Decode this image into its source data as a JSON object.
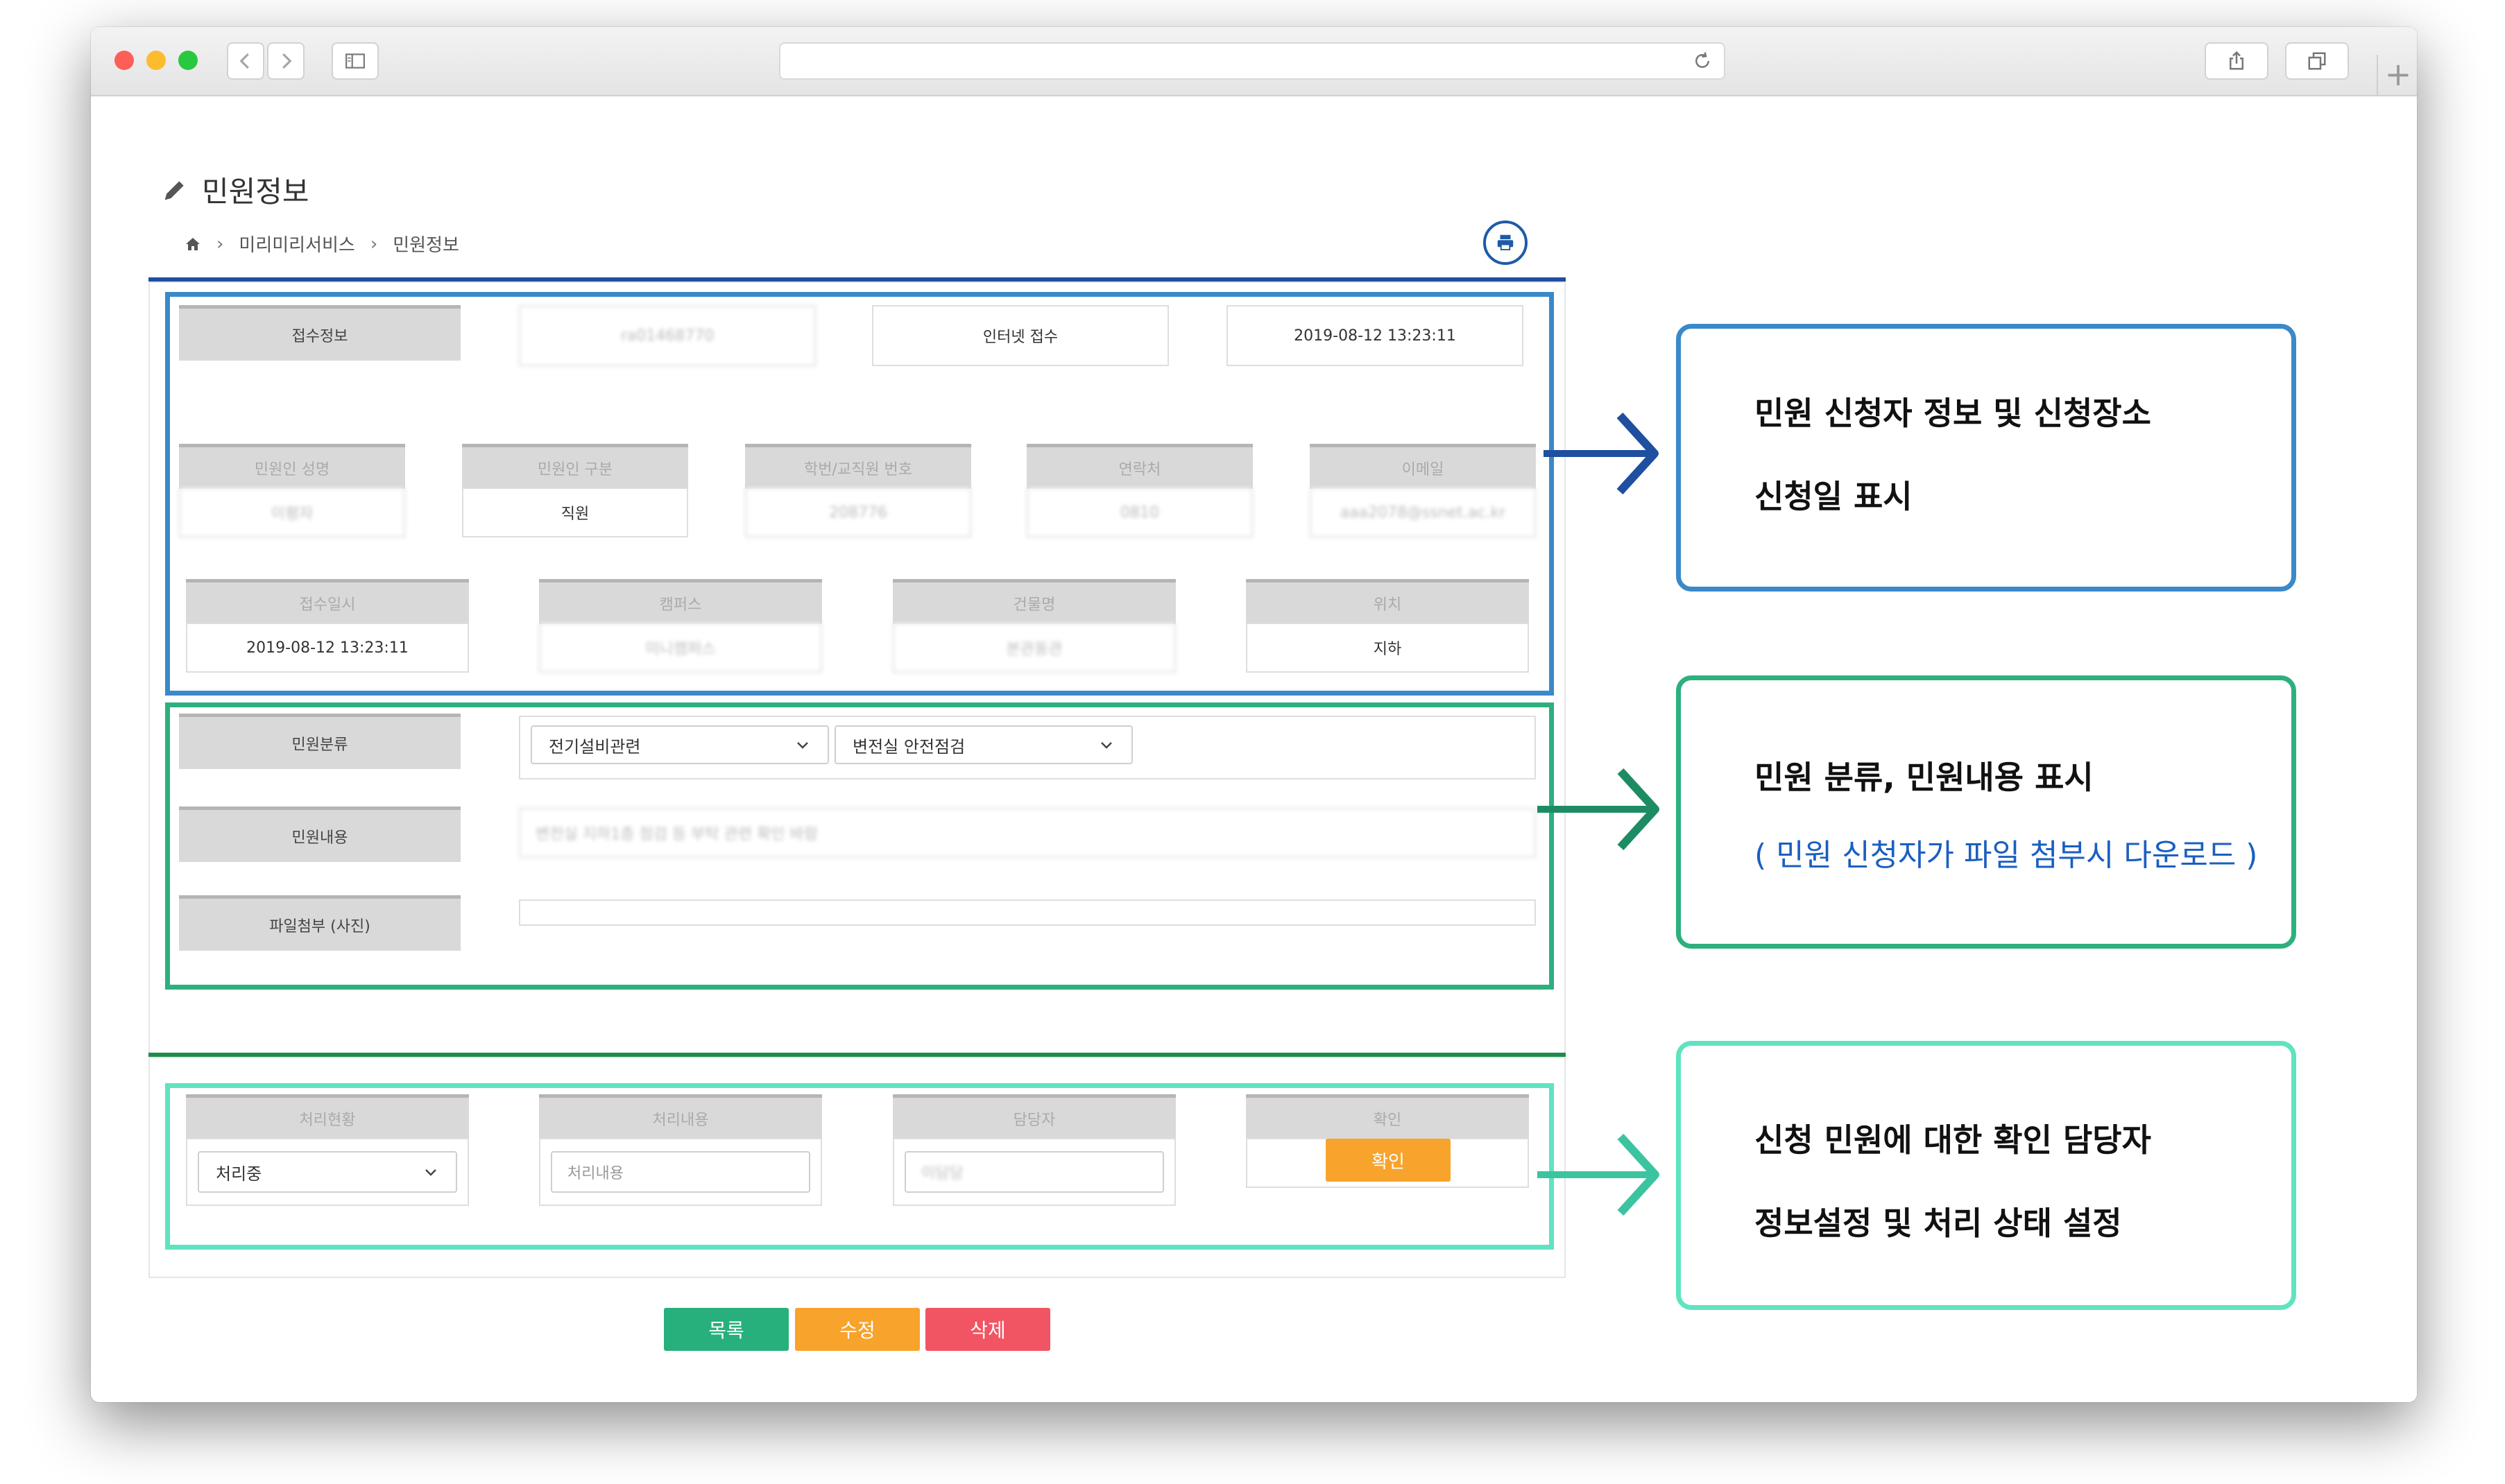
{
  "page": {
    "title": "민원정보",
    "breadcrumb": [
      "미리미리서비스",
      "민원정보"
    ]
  },
  "reception": {
    "label": "접수정보",
    "number": "ra01468770",
    "channel": "인터넷 접수",
    "datetime": "2019-08-12 13:23:11"
  },
  "applicant": {
    "labels": [
      "민원인 성명",
      "민원인 구분",
      "학번/교직원 번호",
      "연락처",
      "이메일"
    ],
    "values": [
      "이평자",
      "직원",
      "208776",
      "0810",
      "aaa2078@ssnet.ac.kr"
    ]
  },
  "location": {
    "labels": [
      "접수일시",
      "캠퍼스",
      "건물명",
      "위치"
    ],
    "values": [
      "2019-08-12 13:23:11",
      "미니캠퍼스",
      "본관동관",
      "지하"
    ]
  },
  "complaint": {
    "category_label": "민원분류",
    "category1": "전기설비관련",
    "category2": "변전실 안전점검",
    "content_label": "민원내용",
    "content_value": "변전실 지하1층 점검 등 부탁 관련 확인 바람",
    "file_label": "파일첨부 (사진)"
  },
  "processing": {
    "labels": [
      "처리현황",
      "처리내용",
      "담당자",
      "확인"
    ],
    "status_value": "처리중",
    "content_placeholder": "처리내용",
    "manager_value": "이담당",
    "confirm_button": "확인"
  },
  "actions": {
    "list": "목록",
    "edit": "수정",
    "delete": "삭제"
  },
  "notes": {
    "note1": [
      "민원 신청자 정보 및 신청장소",
      "신청일 표시"
    ],
    "note2": [
      "민원 분류, 민원내용 표시",
      "( 민원 신청자가 파일 첨부시 다운로드 )"
    ],
    "note3": [
      "신청 민원에 대한 확인 담당자",
      "정보설정 및 처리 상태 설정"
    ]
  },
  "colors": {
    "outline1": "#3a89c9",
    "outline2": "#2db07e",
    "outline3": "#5fe3c0",
    "header_rule": "#1e4fa0",
    "list_button": "#27b07c",
    "edit_button": "#f7a32c",
    "delete_button": "#f15563"
  }
}
